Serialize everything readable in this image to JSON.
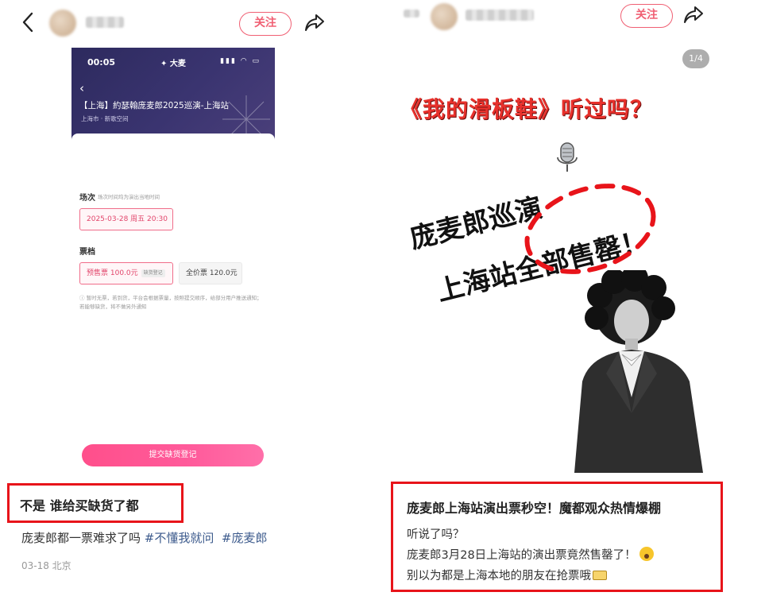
{
  "left": {
    "follow_label": "关注",
    "phone": {
      "time": "00:05",
      "brand": "大麦",
      "title": "【上海】約瑟翰庞麦郎2025巡演-上海站",
      "subtitle": "上海市 · 新歌空间",
      "session_label": "场次",
      "session_hint": "场次时间均为演出当地时间",
      "session_value": "2025-03-28 周五 20:30",
      "tier_label": "票档",
      "tier_presale": "预售票 100.0元",
      "tier_presale_tag": "缺货登记",
      "tier_full": "全价票 120.0元",
      "notice": "暂时无票，若到货，平台会根据票量，按照提交顺序，给部分用户推送通知；若能够缺货，将不做另外通知",
      "submit_label": "提交缺货登记"
    },
    "note_title": "不是 谁给买缺货了都",
    "note_text": "庞麦郎都一票难求了吗",
    "hashtags": [
      "#不懂我就问",
      "#庞麦郎"
    ],
    "date": "03-18 北京"
  },
  "right": {
    "follow_label": "关注",
    "page_indicator": "1/4",
    "poster_title": "《我的滑板鞋》听过吗？",
    "poster_line1": "庞麦郎巡演",
    "poster_line2": "上海站全部售罄！",
    "note_title": "庞麦郎上海站演出票秒空！魔都观众热情爆棚",
    "note_lines": [
      "听说了吗？",
      "庞麦郎3月28日上海站的演出票竟然售罄了！",
      "别以为都是上海本地的朋友在抢票哦"
    ]
  },
  "colors": {
    "accent": "#f05f73",
    "highlight_box": "#e8141a",
    "hashtag": "#3c5a8c",
    "poster_red": "#e8312c"
  }
}
